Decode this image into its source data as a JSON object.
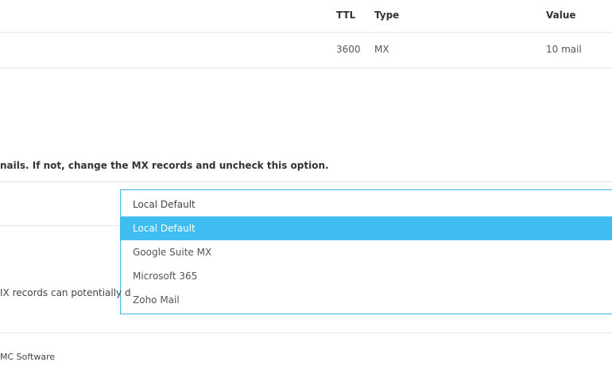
{
  "table": {
    "headers": {
      "ttl": "TTL",
      "type": "Type",
      "value": "Value"
    },
    "row": {
      "ttl": "3600",
      "type": "MX",
      "value": "10 mail"
    }
  },
  "note_text": "nails. If not, change the MX records and uncheck this option.",
  "mx_select": {
    "current": "Local Default",
    "options": [
      "Local Default",
      "Google Suite MX",
      "Microsoft 365",
      "Zoho Mail"
    ],
    "selected_index": 0
  },
  "warning_text": "IX records can potentially d",
  "footer_text": "MC Software",
  "colors": {
    "accent": "#3fbdf0",
    "border": "#3fb6e6"
  }
}
